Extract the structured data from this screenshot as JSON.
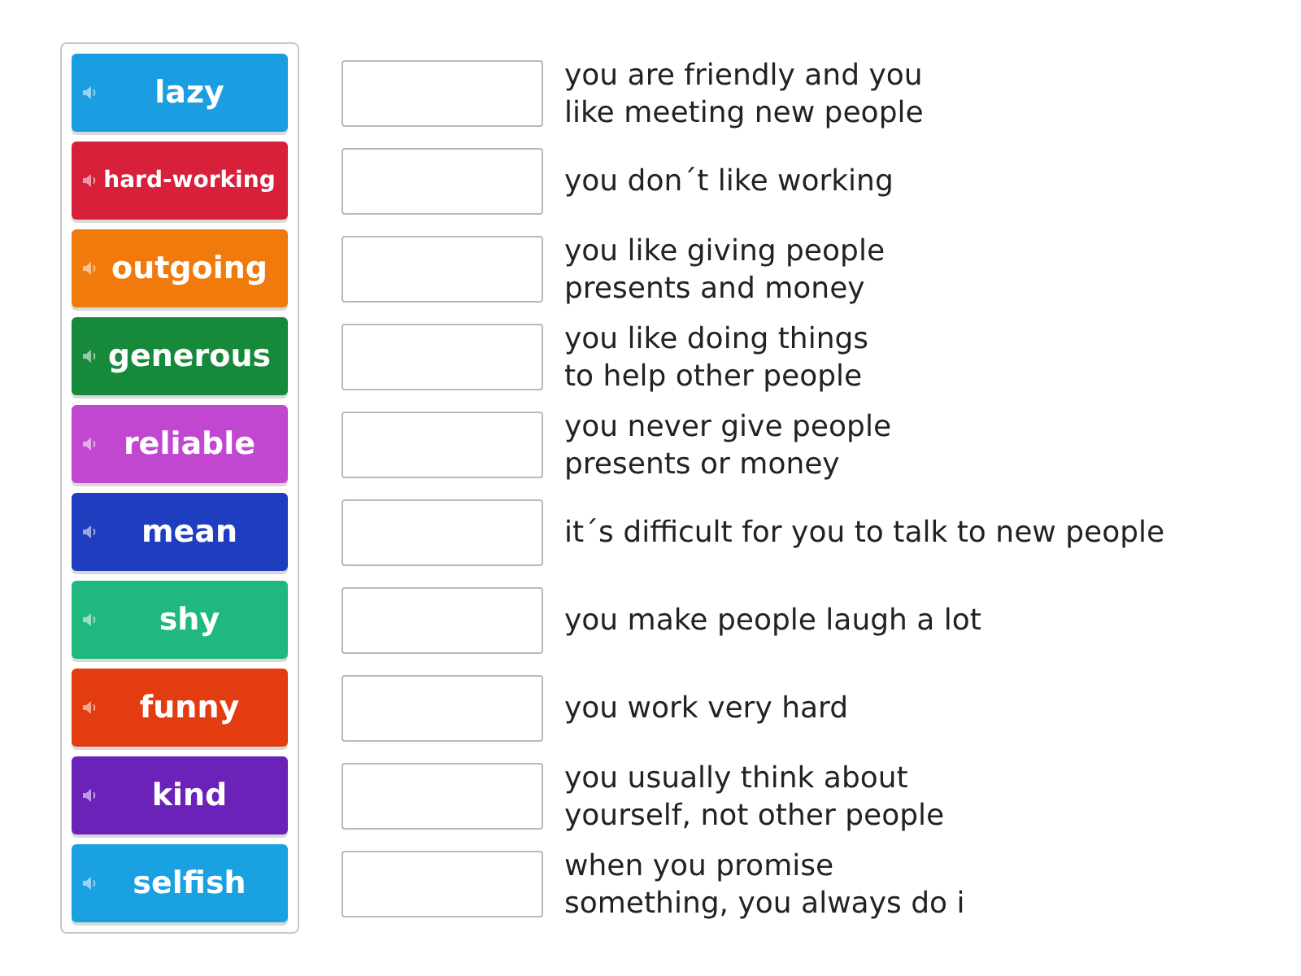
{
  "tiles": [
    {
      "label": "lazy",
      "color": "#1b9de2"
    },
    {
      "label": "hard-working",
      "color": "#d9203b"
    },
    {
      "label": "outgoing",
      "color": "#f07a0b"
    },
    {
      "label": "generous",
      "color": "#17893b"
    },
    {
      "label": "reliable",
      "color": "#c247d0"
    },
    {
      "label": "mean",
      "color": "#1f3dbf"
    },
    {
      "label": "shy",
      "color": "#1fb87f"
    },
    {
      "label": "funny",
      "color": "#e23c10"
    },
    {
      "label": "kind",
      "color": "#6a22b8"
    },
    {
      "label": "selfish",
      "color": "#1aa1e2"
    }
  ],
  "definitions": [
    "you are friendly and you\nlike meeting new people",
    "you don´t like working",
    "you like giving people\npresents and money",
    "you like doing things\nto help other people",
    "you never give people\npresents or money",
    "it´s difficult for you to talk to new people",
    "you make people laugh a lot",
    "you work very hard",
    "you usually think about\nyourself, not other people",
    "when you promise\nsomething, you always do i"
  ]
}
